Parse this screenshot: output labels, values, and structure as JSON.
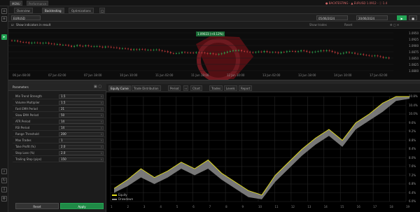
{
  "topbar": {
    "btn1": "MENU",
    "btn2": "Performance",
    "status": "● BACKTESTING · ▲ EURUSD 1.0912 · ⓘ 1.4"
  },
  "tabs": [
    "Overview",
    "Backtesting",
    "Optimizations"
  ],
  "symbol_row": {
    "symbol": "EURUSD",
    "date_from": "05/06/2024",
    "date_to": "20/06/2024"
  },
  "chart_options": {
    "checkbox_label": "Show indicators in result",
    "right_label": "Show trades",
    "right_btn": "Reset"
  },
  "price_chart": {
    "ticker": "1.09023 (+0.12%)",
    "y_ticks": [
      "1.0950",
      "1.0925",
      "1.0900",
      "1.0875",
      "1.0850",
      "1.0825",
      "1.0800"
    ],
    "x_ticks": [
      "06 Jun 08:00",
      "07 Jun 02:00",
      "07 Jun 18:00",
      "10 Jun 10:00",
      "11 Jun 02:00",
      "11 Jun 18:00",
      "12 Jun 10:00",
      "13 Jun 02:00",
      "13 Jun 18:00",
      "14 Jun 10:00",
      "17 Jun 02:00"
    ]
  },
  "params": {
    "title": "Parameters",
    "rows": [
      {
        "label": "Min Trend Strength",
        "value": "1.5"
      },
      {
        "label": "Volume Multiplier",
        "value": "1.5"
      },
      {
        "label": "Fast EMA Period",
        "value": "21"
      },
      {
        "label": "Slow EMA Period",
        "value": "50"
      },
      {
        "label": "ATR Period",
        "value": "14"
      },
      {
        "label": "RSI Period",
        "value": "14"
      },
      {
        "label": "Range Threshold",
        "value": "200"
      },
      {
        "label": "Max Trades",
        "value": "1"
      },
      {
        "label": "Take Profit (%)",
        "value": "2.0"
      },
      {
        "label": "Stop Loss (%)",
        "value": "2.0"
      },
      {
        "label": "Trailing Stop (pips)",
        "value": "150"
      }
    ],
    "reset": "Reset",
    "apply": "Apply"
  },
  "equity": {
    "tabs": [
      "Equity Curve",
      "Trade Distribution",
      "Period",
      "Chart",
      "Trades",
      "Levels",
      "Report"
    ],
    "y_ticks": [
      "10.8%",
      "10.4%",
      "10.0%",
      "9.6%",
      "9.2%",
      "8.8%",
      "8.4%",
      "8.0%",
      "7.6%",
      "7.2%",
      "6.8%",
      "6.4%",
      "6.0%"
    ],
    "x_ticks": [
      "1",
      "2",
      "3",
      "4",
      "5",
      "6",
      "7",
      "8",
      "9",
      "10",
      "11",
      "12",
      "13",
      "14",
      "15",
      "16",
      "17",
      "18",
      "19"
    ],
    "legend": [
      "Equity",
      "Drawdown"
    ],
    "colors": {
      "equity": "#e6e01c",
      "band": "#8c8c8c"
    }
  },
  "colors": {
    "accent": "#23a455",
    "bg": "#1e1e1e",
    "chart_bg": "#000000"
  }
}
